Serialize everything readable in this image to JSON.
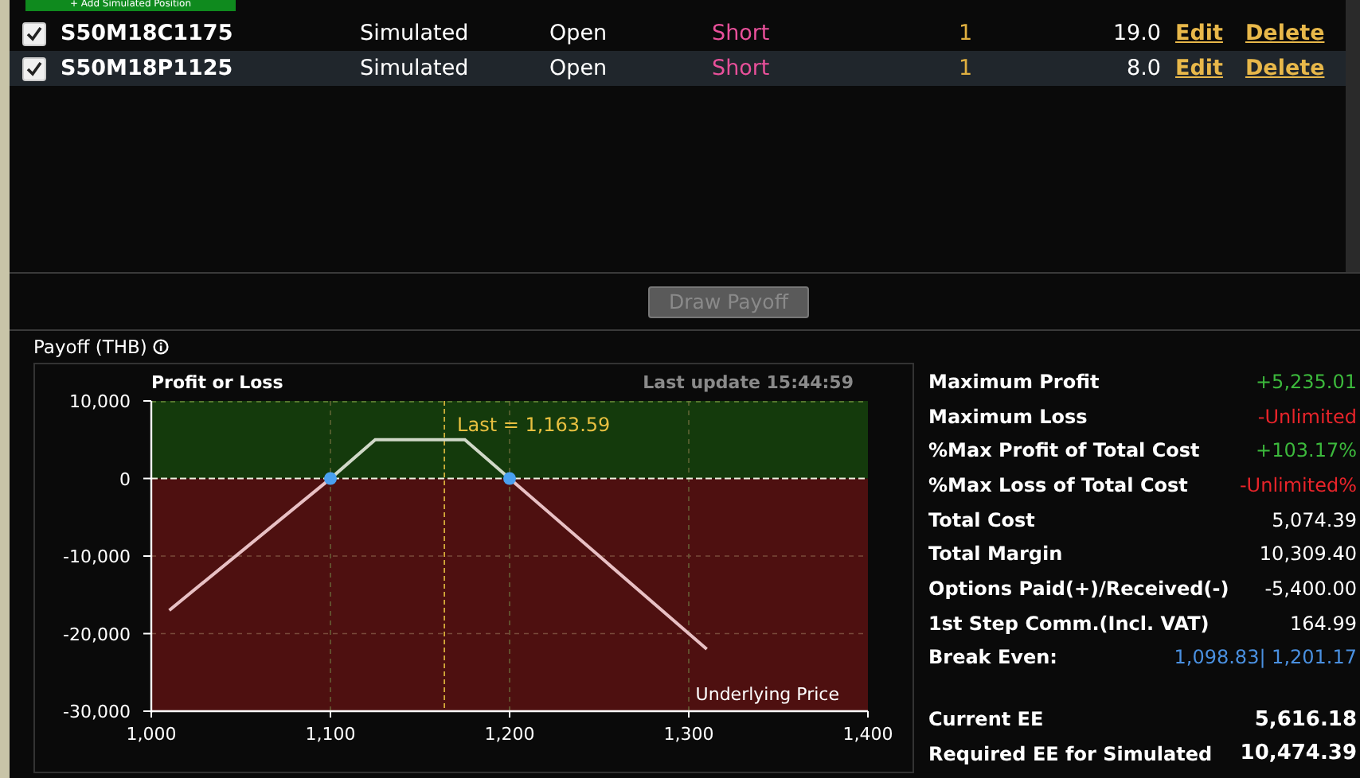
{
  "add_button": "+ Add Simulated Position",
  "positions": [
    {
      "checked": true,
      "selected": false,
      "symbol": "S50M18C1175",
      "type": "Simulated",
      "status": "Open",
      "side": "Short",
      "qty": "1",
      "price": "19.0",
      "edit": "Edit",
      "delete": "Delete"
    },
    {
      "checked": true,
      "selected": true,
      "symbol": "S50M18P1125",
      "type": "Simulated",
      "status": "Open",
      "side": "Short",
      "qty": "1",
      "price": "8.0",
      "edit": "Edit",
      "delete": "Delete"
    }
  ],
  "draw_button": {
    "label": "Draw Payoff",
    "disabled": true
  },
  "payoff": {
    "title": "Payoff (THB)",
    "last_update": "Last update 15:44:59",
    "chart_data": {
      "type": "line",
      "ylabel": "Profit or Loss",
      "xlabel": "Underlying Price",
      "x": [
        1010,
        1100,
        1125,
        1175,
        1200,
        1310
      ],
      "series": [
        {
          "color": "#d0d8c8",
          "values": [
            -17000,
            0,
            5000,
            5000,
            0,
            -22000
          ]
        }
      ],
      "grid": true,
      "bands": [
        {
          "axis": "y",
          "from": 0,
          "to": 10000,
          "color": "#143a0c"
        },
        {
          "axis": "y",
          "from": -30000,
          "to": 0,
          "color": "#4e1010"
        }
      ],
      "ref_lines": [
        {
          "axis": "y",
          "value": 0,
          "color": "#f0f0e0"
        },
        {
          "axis": "x",
          "value": 1163.59,
          "color": "#e8c040"
        }
      ],
      "xlim": [
        1000,
        1400
      ],
      "ylim": [
        -30000,
        10000
      ],
      "xticks": [
        {
          "value": 1000,
          "label": "1,000"
        },
        {
          "value": 1100,
          "label": "1,100"
        },
        {
          "value": 1200,
          "label": "1,200"
        },
        {
          "value": 1300,
          "label": "1,300"
        },
        {
          "value": 1400,
          "label": "1,400"
        }
      ],
      "yticks": [
        {
          "value": 10000,
          "label": "10,000"
        },
        {
          "value": 0,
          "label": "0"
        },
        {
          "value": -10000,
          "label": "-10,000"
        },
        {
          "value": -20000,
          "label": "-20,000"
        },
        {
          "value": -30000,
          "label": "-30,000"
        }
      ],
      "annotations": [
        "Last = 1,163.59"
      ]
    }
  },
  "stats": [
    {
      "label": "Maximum Profit",
      "value": "+5,235.01",
      "color": "#3cb83c"
    },
    {
      "label": "Maximum Loss",
      "value": "-Unlimited",
      "color": "#e8242a"
    },
    {
      "label": "%Max Profit of Total Cost",
      "value": "+103.17%",
      "color": "#3cb83c"
    },
    {
      "label": "%Max Loss of Total Cost",
      "value": "-Unlimited%",
      "color": "#e8242a"
    },
    {
      "label": "Total Cost",
      "value": "5,074.39",
      "color": "#ffffff"
    },
    {
      "label": "Total Margin",
      "value": "10,309.40",
      "color": "#ffffff"
    },
    {
      "label": "Options Paid(+)/Received(-)",
      "value": "-5,400.00",
      "color": "#ffffff"
    },
    {
      "label": "1st Step Comm.(Incl. VAT)",
      "value": "164.99",
      "color": "#ffffff"
    },
    {
      "label": "Break Even:",
      "value": "1,098.83| 1,201.17",
      "color": "#4a90e0"
    }
  ],
  "ee": [
    {
      "label": "Current EE",
      "value": "5,616.18"
    },
    {
      "label": "Required EE for Simulated",
      "value": "10,474.39"
    }
  ]
}
